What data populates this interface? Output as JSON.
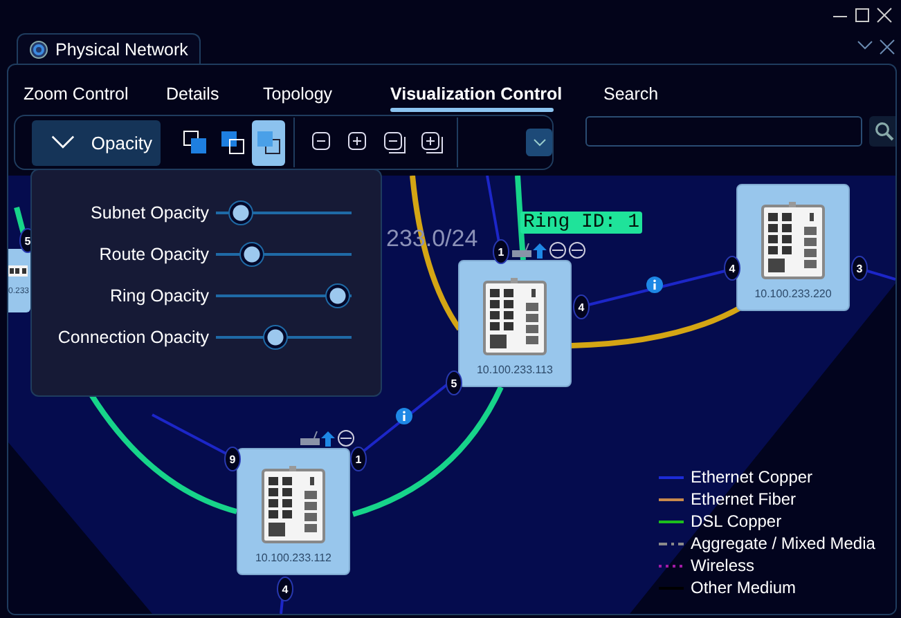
{
  "document_tab": {
    "title": "Physical Network"
  },
  "nav_tabs": [
    {
      "label": "Zoom Control",
      "selected": false
    },
    {
      "label": "Details",
      "selected": false
    },
    {
      "label": "Topology",
      "selected": false
    },
    {
      "label": "Visualization Control",
      "selected": true
    },
    {
      "label": "Search",
      "selected": false
    }
  ],
  "toolbar": {
    "opacity_button": "Opacity",
    "layer_buttons": [
      {
        "selected": false
      },
      {
        "selected": false
      },
      {
        "selected": true
      }
    ]
  },
  "opacity_panel": {
    "sliders": [
      {
        "label": "Subnet Opacity",
        "level": 0.18
      },
      {
        "label": "Route Opacity",
        "level": 0.27
      },
      {
        "label": "Ring Opacity",
        "level": 0.9
      },
      {
        "label": "Connection Opacity",
        "level": 0.44
      }
    ]
  },
  "diagram": {
    "subnet_label": "233.0/24",
    "ring_label": "Ring ID: 1",
    "nodes": [
      {
        "ip": "0.233"
      },
      {
        "ip": "10.100.233.113"
      },
      {
        "ip": "10.100.233.220"
      },
      {
        "ip": "10.100.233.112"
      }
    ],
    "port_badges": [
      "5",
      "1",
      "4",
      "5",
      "4",
      "3",
      "9",
      "1",
      "4"
    ]
  },
  "legend": [
    {
      "label": "Ethernet Copper",
      "color": "#1c2bd6",
      "kind": "solid"
    },
    {
      "label": "Ethernet Fiber",
      "color": "#c88a4c",
      "kind": "solid"
    },
    {
      "label": "DSL Copper",
      "color": "#1cbf1c",
      "kind": "solid"
    },
    {
      "label": "Aggregate / Mixed Media",
      "color": "#8a8a8a",
      "kind": "dashed"
    },
    {
      "label": "Wireless",
      "color": "#a01aa6",
      "kind": "dotted"
    },
    {
      "label": "Other Medium",
      "color": "#000000",
      "kind": "solid"
    }
  ]
}
